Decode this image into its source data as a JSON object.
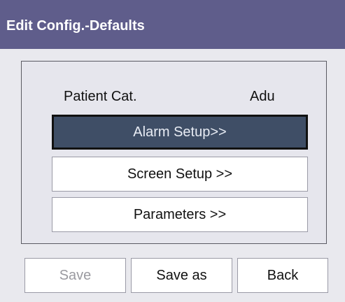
{
  "window": {
    "title": "Edit Config.-Defaults"
  },
  "panel": {
    "patient_label": "Patient Cat.",
    "patient_value": "Adu",
    "buttons": [
      {
        "label": "Alarm Setup>>",
        "selected": true
      },
      {
        "label": "Screen Setup >>",
        "selected": false
      },
      {
        "label": "Parameters >>",
        "selected": false
      }
    ]
  },
  "footer": {
    "save_label": "Save",
    "save_enabled": false,
    "save_as_label": "Save as",
    "back_label": "Back"
  },
  "colors": {
    "titlebar": "#5f5d8b",
    "selected_button": "#3f4e66",
    "background": "#e9e9ee"
  }
}
